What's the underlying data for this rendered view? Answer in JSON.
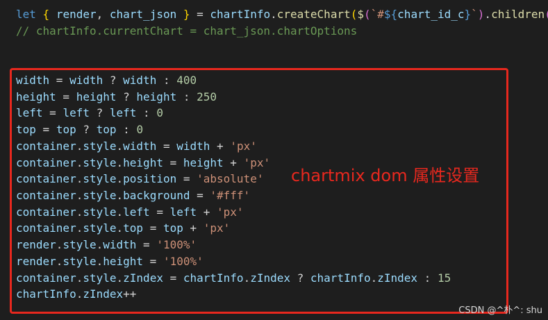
{
  "editor": {
    "lines": [
      [
        [
          "kw",
          "let"
        ],
        [
          "pun",
          " "
        ],
        [
          "brk1",
          "{"
        ],
        [
          "pun",
          " "
        ],
        [
          "var",
          "render"
        ],
        [
          "pun",
          ", "
        ],
        [
          "var",
          "chart_json"
        ],
        [
          "pun",
          " "
        ],
        [
          "brk1",
          "}"
        ],
        [
          "pun",
          " = "
        ],
        [
          "var",
          "chartInfo"
        ],
        [
          "pun",
          "."
        ],
        [
          "fn",
          "createChart"
        ],
        [
          "brk1",
          "("
        ],
        [
          "fn",
          "$"
        ],
        [
          "brk2",
          "("
        ],
        [
          "str",
          "`#"
        ],
        [
          "kw",
          "${"
        ],
        [
          "var",
          "chart_id_c"
        ],
        [
          "kw",
          "}"
        ],
        [
          "str",
          "`"
        ],
        [
          "brk2",
          ")"
        ],
        [
          "pun",
          "."
        ],
        [
          "fn",
          "children"
        ],
        [
          "brk2",
          "("
        ]
      ],
      [
        [
          "cmt",
          "// chartInfo.currentChart = chart_json.chartOptions"
        ]
      ],
      [
        [
          "var",
          "width"
        ],
        [
          "pun",
          " = "
        ],
        [
          "var",
          "width"
        ],
        [
          "pun",
          " ? "
        ],
        [
          "var",
          "width"
        ],
        [
          "pun",
          " : "
        ],
        [
          "num",
          "400"
        ]
      ],
      [
        [
          "var",
          "height"
        ],
        [
          "pun",
          " = "
        ],
        [
          "var",
          "height"
        ],
        [
          "pun",
          " ? "
        ],
        [
          "var",
          "height"
        ],
        [
          "pun",
          " : "
        ],
        [
          "num",
          "250"
        ]
      ],
      [
        [
          "var",
          "left"
        ],
        [
          "pun",
          " = "
        ],
        [
          "var",
          "left"
        ],
        [
          "pun",
          " ? "
        ],
        [
          "var",
          "left"
        ],
        [
          "pun",
          " : "
        ],
        [
          "num",
          "0"
        ]
      ],
      [
        [
          "var",
          "top"
        ],
        [
          "pun",
          " = "
        ],
        [
          "var",
          "top"
        ],
        [
          "pun",
          " ? "
        ],
        [
          "var",
          "top"
        ],
        [
          "pun",
          " : "
        ],
        [
          "num",
          "0"
        ]
      ],
      [
        [
          "var",
          "container"
        ],
        [
          "pun",
          "."
        ],
        [
          "var",
          "style"
        ],
        [
          "pun",
          "."
        ],
        [
          "var",
          "width"
        ],
        [
          "pun",
          " = "
        ],
        [
          "var",
          "width"
        ],
        [
          "pun",
          " + "
        ],
        [
          "str",
          "'px'"
        ]
      ],
      [
        [
          "var",
          "container"
        ],
        [
          "pun",
          "."
        ],
        [
          "var",
          "style"
        ],
        [
          "pun",
          "."
        ],
        [
          "var",
          "height"
        ],
        [
          "pun",
          " = "
        ],
        [
          "var",
          "height"
        ],
        [
          "pun",
          " + "
        ],
        [
          "str",
          "'px'"
        ]
      ],
      [
        [
          "var",
          "container"
        ],
        [
          "pun",
          "."
        ],
        [
          "var",
          "style"
        ],
        [
          "pun",
          "."
        ],
        [
          "var",
          "position"
        ],
        [
          "pun",
          " = "
        ],
        [
          "str",
          "'absolute'"
        ]
      ],
      [
        [
          "var",
          "container"
        ],
        [
          "pun",
          "."
        ],
        [
          "var",
          "style"
        ],
        [
          "pun",
          "."
        ],
        [
          "var",
          "background"
        ],
        [
          "pun",
          " = "
        ],
        [
          "str",
          "'#fff'"
        ]
      ],
      [
        [
          "var",
          "container"
        ],
        [
          "pun",
          "."
        ],
        [
          "var",
          "style"
        ],
        [
          "pun",
          "."
        ],
        [
          "var",
          "left"
        ],
        [
          "pun",
          " = "
        ],
        [
          "var",
          "left"
        ],
        [
          "pun",
          " + "
        ],
        [
          "str",
          "'px'"
        ]
      ],
      [
        [
          "var",
          "container"
        ],
        [
          "pun",
          "."
        ],
        [
          "var",
          "style"
        ],
        [
          "pun",
          "."
        ],
        [
          "var",
          "top"
        ],
        [
          "pun",
          " = "
        ],
        [
          "var",
          "top"
        ],
        [
          "pun",
          " + "
        ],
        [
          "str",
          "'px'"
        ]
      ],
      [
        [
          "var",
          "render"
        ],
        [
          "pun",
          "."
        ],
        [
          "var",
          "style"
        ],
        [
          "pun",
          "."
        ],
        [
          "var",
          "width"
        ],
        [
          "pun",
          " = "
        ],
        [
          "str",
          "'100%'"
        ]
      ],
      [
        [
          "var",
          "render"
        ],
        [
          "pun",
          "."
        ],
        [
          "var",
          "style"
        ],
        [
          "pun",
          "."
        ],
        [
          "var",
          "height"
        ],
        [
          "pun",
          " = "
        ],
        [
          "str",
          "'100%'"
        ]
      ],
      [
        [
          "var",
          "container"
        ],
        [
          "pun",
          "."
        ],
        [
          "var",
          "style"
        ],
        [
          "pun",
          "."
        ],
        [
          "var",
          "zIndex"
        ],
        [
          "pun",
          " = "
        ],
        [
          "var",
          "chartInfo"
        ],
        [
          "pun",
          "."
        ],
        [
          "var",
          "zIndex"
        ],
        [
          "pun",
          " ? "
        ],
        [
          "var",
          "chartInfo"
        ],
        [
          "pun",
          "."
        ],
        [
          "var",
          "zIndex"
        ],
        [
          "pun",
          " : "
        ],
        [
          "num",
          "15"
        ]
      ],
      [
        [
          "var",
          "chartInfo"
        ],
        [
          "pun",
          "."
        ],
        [
          "var",
          "zIndex"
        ],
        [
          "pun",
          "++"
        ]
      ]
    ]
  },
  "annotation": "chartmix dom 属性设置",
  "watermark": "CSDN @^朴^: shu"
}
